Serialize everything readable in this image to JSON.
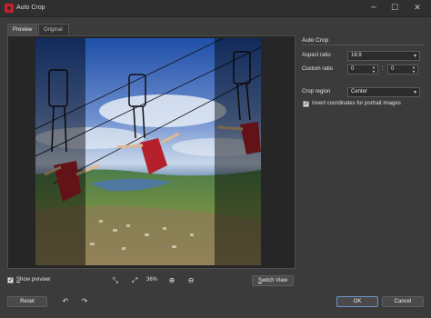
{
  "window": {
    "title": "Auto Crop",
    "minimize": "─",
    "maximize": "☐",
    "close": "✕"
  },
  "tabs": [
    {
      "label": "Preview",
      "active": true
    },
    {
      "label": "Original",
      "active": false
    }
  ],
  "panel": {
    "section_title": "Auto Crop",
    "aspect_ratio": {
      "label": "Aspect ratio",
      "value": "16:9"
    },
    "custom_ratio": {
      "label": "Custom ratio",
      "width": "0",
      "separator": ":",
      "height": "0"
    },
    "crop_region": {
      "label": "Crop region",
      "value": "Center"
    },
    "invert_coords": {
      "label": "Invert coordinates for portrait images",
      "checked": true
    }
  },
  "bottom_bar": {
    "show_preview": {
      "label": "Show preview",
      "mnemonic": "S",
      "rest": "how preview",
      "checked": true
    },
    "zoom": "36%",
    "switch_view": {
      "mnemonic": "S",
      "rest": "witch View"
    }
  },
  "footer": {
    "reset": "Reset",
    "ok": "OK",
    "cancel": "Cancel"
  },
  "icons": {
    "fit": "fit-to-window-icon",
    "actual": "actual-size-icon",
    "zoom_in": "zoom-in-icon",
    "zoom_out": "zoom-out-icon",
    "undo": "undo-icon",
    "redo": "redo-icon"
  },
  "colors": {
    "background": "#3b3b3b",
    "accent": "#6b93c9",
    "brand": "#c8202a"
  }
}
